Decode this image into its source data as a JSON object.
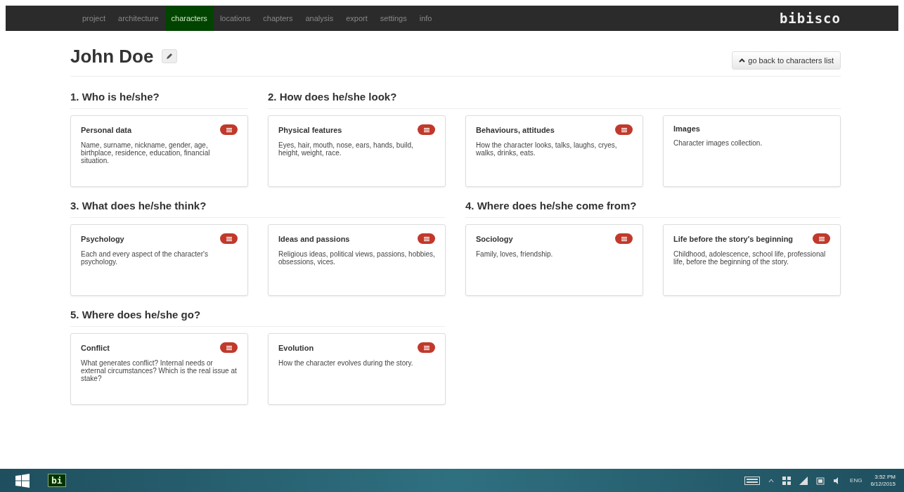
{
  "navbar": {
    "items": [
      {
        "label": "project",
        "selected": false
      },
      {
        "label": "architecture",
        "selected": false
      },
      {
        "label": "characters",
        "selected": true
      },
      {
        "label": "locations",
        "selected": false
      },
      {
        "label": "chapters",
        "selected": false
      },
      {
        "label": "analysis",
        "selected": false
      },
      {
        "label": "export",
        "selected": false
      },
      {
        "label": "settings",
        "selected": false
      },
      {
        "label": "info",
        "selected": false
      }
    ],
    "brand": "bibisco"
  },
  "header": {
    "title": "John Doe",
    "back_button": "go back to characters list"
  },
  "rows": [
    {
      "sections": [
        {
          "title": "1. Who is he/she?",
          "cards": [
            {
              "title": "Personal data",
              "text": "Name, surname, nickname, gender, age, birthplace, residence, education, financial situation.",
              "badge": true
            }
          ]
        },
        {
          "title": "2. How does he/she look?",
          "cards": [
            {
              "title": "Physical features",
              "text": "Eyes, hair, mouth, nose, ears, hands, build, height, weight, race.",
              "badge": true
            },
            {
              "title": "Behaviours, attitudes",
              "text": "How the character looks, talks, laughs, cryes, walks, drinks, eats.",
              "badge": true
            },
            {
              "title": "Images",
              "text": "Character images collection.",
              "badge": false
            }
          ]
        }
      ]
    },
    {
      "sections": [
        {
          "title": "3. What does he/she think?",
          "cards": [
            {
              "title": "Psychology",
              "text": "Each and every aspect of the character's psychology.",
              "badge": true
            },
            {
              "title": "Ideas and passions",
              "text": "Religious ideas, political views, passions, hobbies, obsessions, vices.",
              "badge": true
            }
          ]
        },
        {
          "title": "4. Where does he/she come from?",
          "cards": [
            {
              "title": "Sociology",
              "text": "Family, loves, friendship.",
              "badge": true
            },
            {
              "title": "Life before the story's beginning",
              "text": "Childhood, adolescence, school life, professional life, before the beginning of the story.",
              "badge": true
            }
          ]
        }
      ]
    },
    {
      "sections": [
        {
          "title": "5. Where does he/she go?",
          "cards": [
            {
              "title": "Conflict",
              "text": "What generates conflict? Internal needs or external circumstances? Which is the real issue at stake?",
              "badge": true
            },
            {
              "title": "Evolution",
              "text": "How the character evolves during the story.",
              "badge": true
            }
          ]
        }
      ]
    }
  ],
  "taskbar": {
    "app": "bi",
    "language": "ENG",
    "time": "3:52 PM",
    "date": "6/12/2015"
  }
}
